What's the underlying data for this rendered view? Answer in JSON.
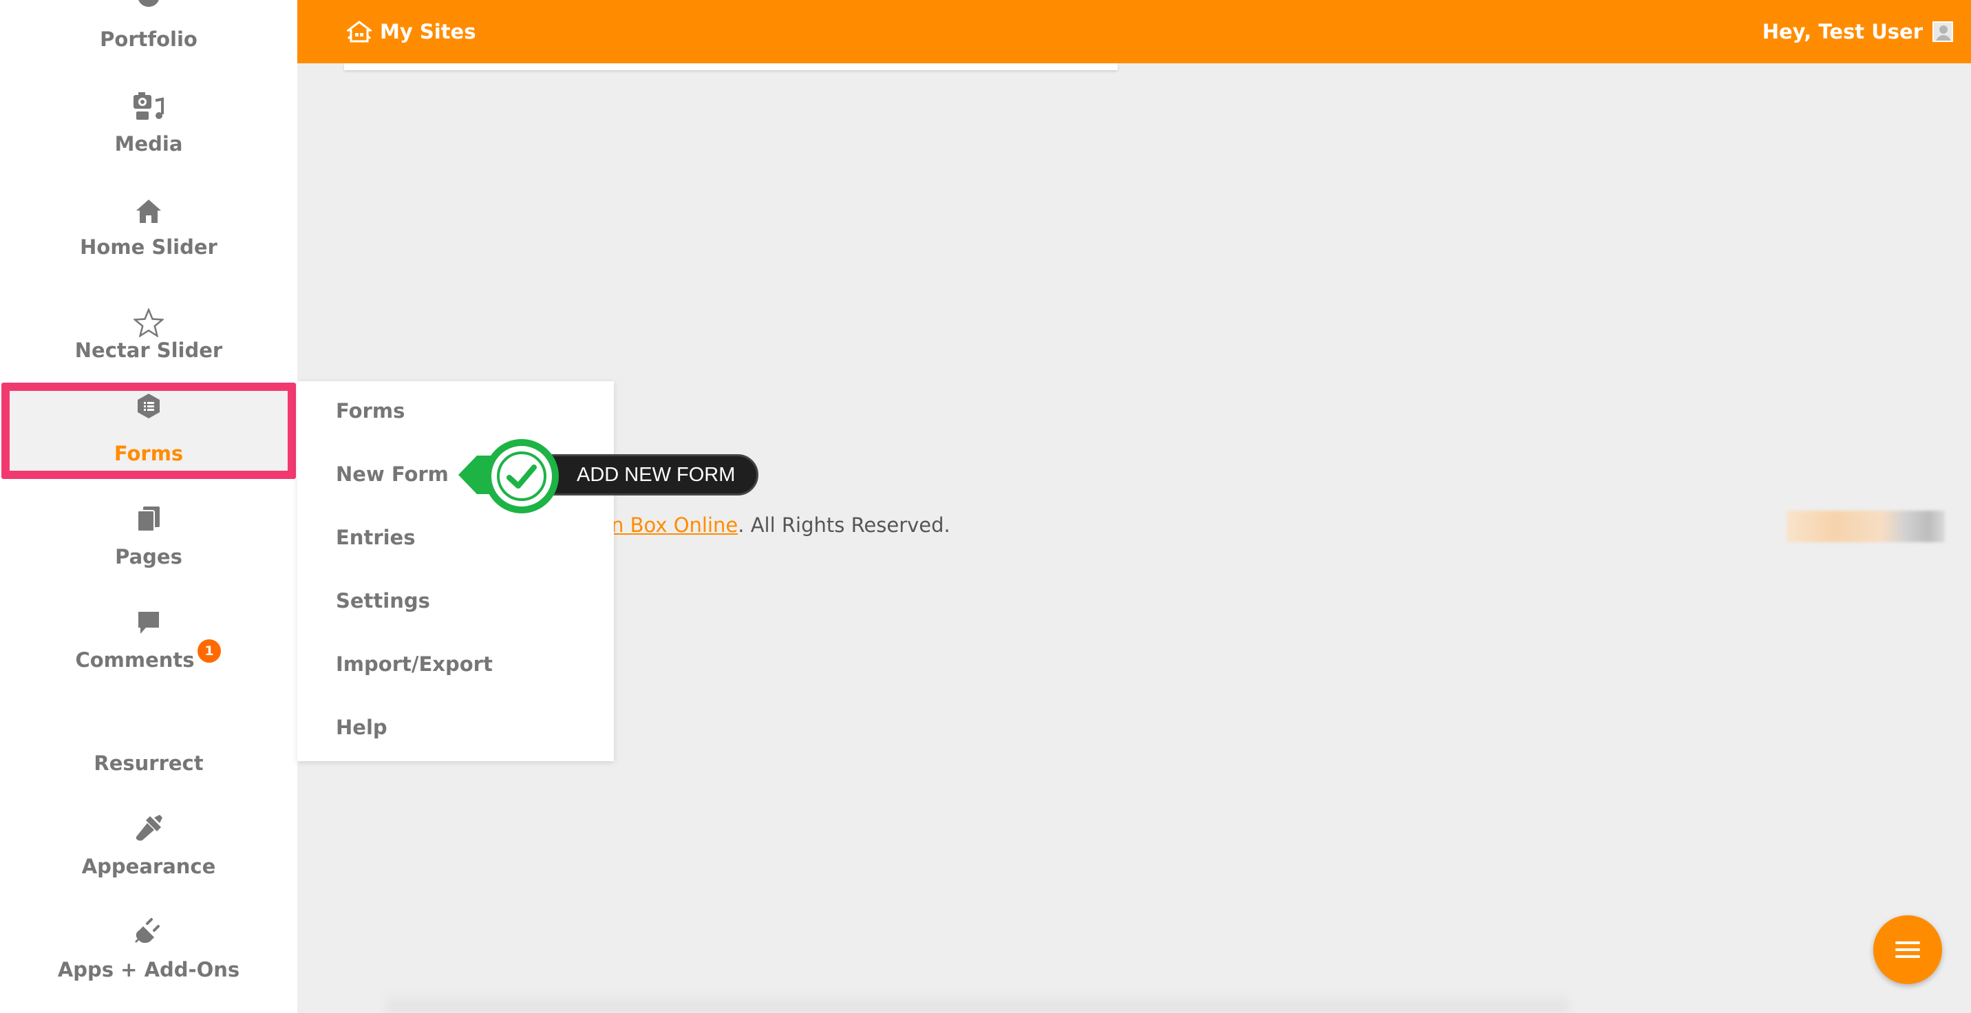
{
  "topbar": {
    "my_sites_label": "My Sites",
    "greeting": "Hey, Test User"
  },
  "sidebar": {
    "items": [
      {
        "label": "Portfolio",
        "icon": "portfolio-icon"
      },
      {
        "label": "Media",
        "icon": "media-icon"
      },
      {
        "label": "Home Slider",
        "icon": "home-icon"
      },
      {
        "label": "Nectar Slider",
        "icon": "star-icon"
      },
      {
        "label": "Forms",
        "icon": "forms-icon",
        "active": true
      },
      {
        "label": "Pages",
        "icon": "pages-icon"
      },
      {
        "label": "Comments",
        "icon": "comment-icon",
        "badge": "1"
      },
      {
        "label": "Resurrect",
        "icon": ""
      },
      {
        "label": "Appearance",
        "icon": "brush-icon"
      },
      {
        "label": "Apps + Add-Ons",
        "icon": "plug-icon"
      }
    ]
  },
  "submenu": {
    "items": [
      "Forms",
      "New Form",
      "Entries",
      "Settings",
      "Import/Export",
      "Help"
    ]
  },
  "callout": {
    "label": "ADD NEW FORM"
  },
  "footer": {
    "link_text": "n Box Online",
    "suffix": ". All Rights Reserved."
  },
  "colors": {
    "accent": "#ff8c00",
    "highlight": "#f2396f",
    "callout_green": "#1db345",
    "badge": "#ff6a00"
  }
}
